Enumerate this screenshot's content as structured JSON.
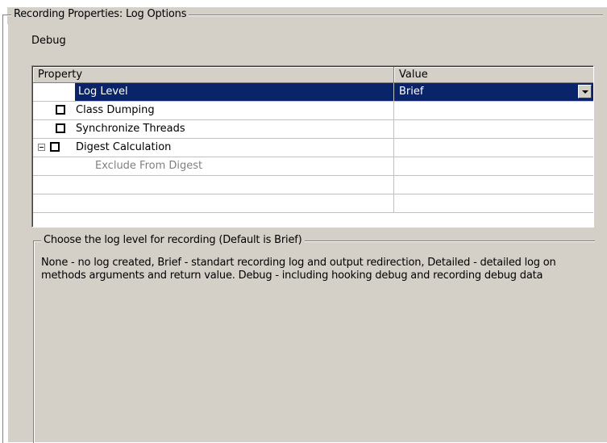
{
  "group": {
    "title": "Recording Properties: Log Options"
  },
  "section": {
    "label": "Debug"
  },
  "grid": {
    "headers": {
      "property": "Property",
      "value": "Value"
    },
    "rows": [
      {
        "name": "Log Level",
        "value": "Brief",
        "selected": true,
        "checkbox": false,
        "expander": false,
        "disabled": false
      },
      {
        "name": "Class Dumping",
        "value": "",
        "selected": false,
        "checkbox": true,
        "expander": false,
        "disabled": false
      },
      {
        "name": "Synchronize Threads",
        "value": "",
        "selected": false,
        "checkbox": true,
        "expander": false,
        "disabled": false
      },
      {
        "name": "Digest Calculation",
        "value": "",
        "selected": false,
        "checkbox": true,
        "expander": true,
        "disabled": false
      },
      {
        "name": "Exclude From Digest",
        "value": "",
        "selected": false,
        "checkbox": false,
        "expander": false,
        "disabled": true
      },
      {
        "name": "",
        "value": ""
      },
      {
        "name": "",
        "value": ""
      }
    ]
  },
  "description": {
    "title": "Choose the log level for recording (Default is Brief)",
    "text": "None - no log created, Brief - standart recording log and output redirection, Detailed - detailed log on methods arguments and return value. Debug - including hooking debug and recording debug data"
  },
  "colors": {
    "selection": "#0a246a",
    "face": "#d4d0c8"
  }
}
